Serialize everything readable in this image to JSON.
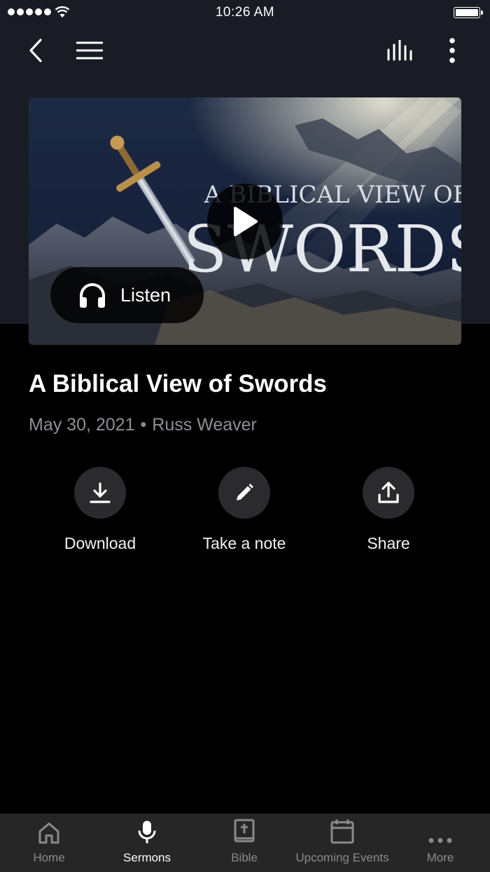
{
  "status_bar": {
    "time": "10:26 AM"
  },
  "sermon": {
    "title": "A Biblical View of Swords",
    "date": "May 30, 2021",
    "separator": "•",
    "speaker": "Russ Weaver",
    "artwork_text_line1": "A BIBLICAL VIEW OF",
    "artwork_text_line2": "SWORDS",
    "listen_label": "Listen"
  },
  "actions": {
    "download_label": "Download",
    "note_label": "Take a note",
    "share_label": "Share"
  },
  "tab_bar": {
    "home": "Home",
    "sermons": "Sermons",
    "bible": "Bible",
    "events": "Upcoming Events",
    "more": "More",
    "active": "Sermons"
  },
  "icons": [
    "back-icon",
    "menu-icon",
    "equalizer-icon",
    "more-vertical-icon",
    "play-icon",
    "headphones-icon",
    "download-icon",
    "pencil-icon",
    "share-icon",
    "home-icon",
    "microphone-icon",
    "bible-icon",
    "calendar-icon",
    "more-horizontal-icon"
  ],
  "colors": {
    "header_bg": "#191c25",
    "page_bg": "#000000",
    "tab_bar_bg": "#262626",
    "muted_text": "#8e8e93"
  }
}
